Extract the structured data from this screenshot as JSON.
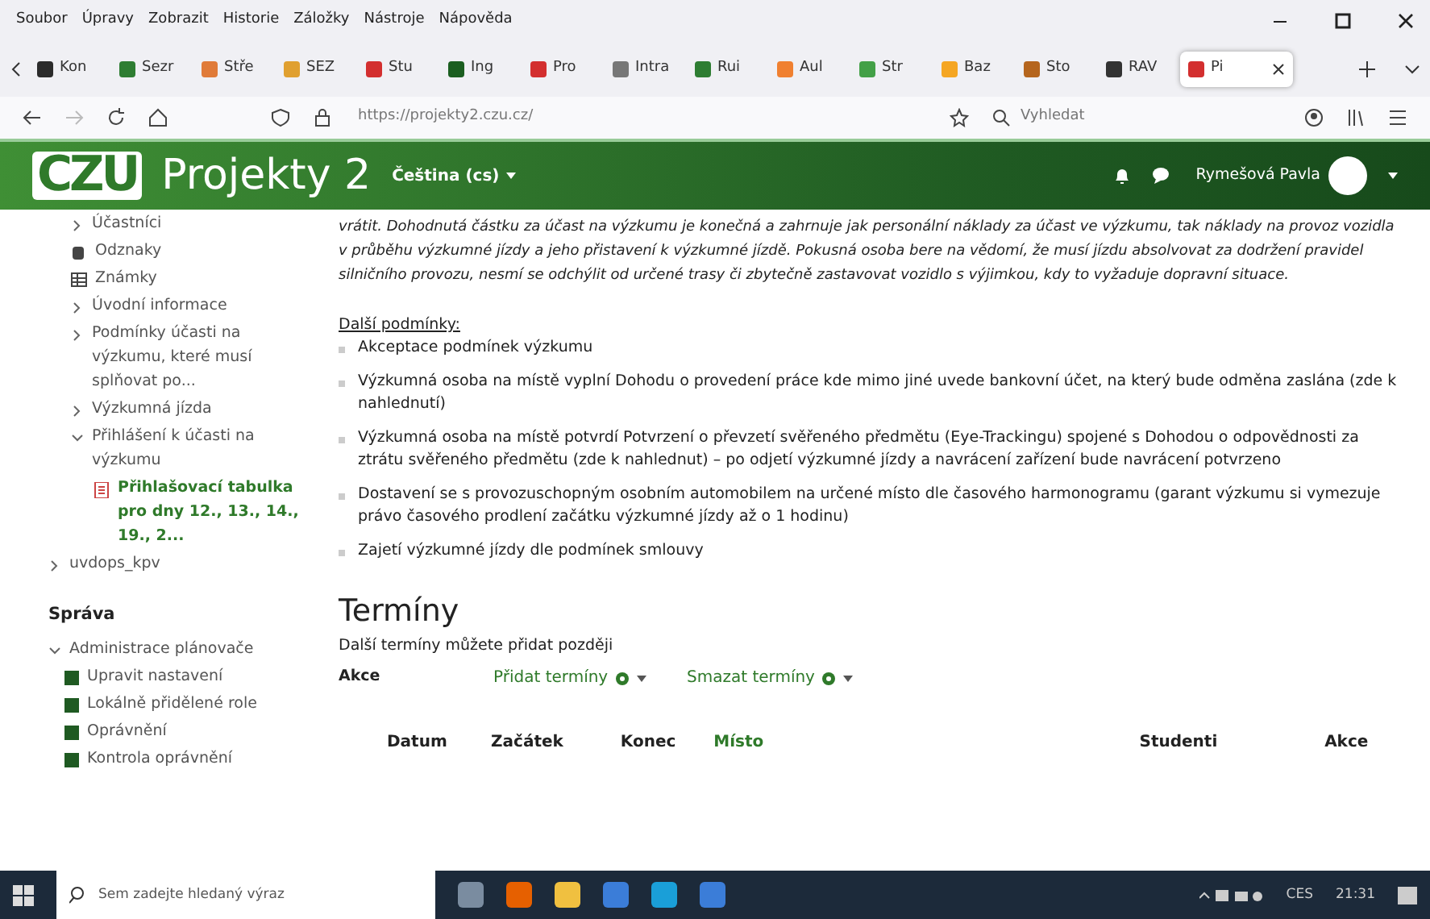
{
  "menu_bar": [
    "Soubor",
    "Úpravy",
    "Zobrazit",
    "Historie",
    "Záložky",
    "Nástroje",
    "Nápověda"
  ],
  "tabs": [
    {
      "label": "Kon",
      "color": "#2b2b2b",
      "selected": false
    },
    {
      "label": "Sezr",
      "color": "#2e7d32",
      "selected": false
    },
    {
      "label": "Stře",
      "color": "#e07b39",
      "selected": false
    },
    {
      "label": "SEZ",
      "color": "#e0a030",
      "selected": false
    },
    {
      "label": "Stu",
      "color": "#d32f2f",
      "selected": false
    },
    {
      "label": "Ing",
      "color": "#1b5e20",
      "selected": false
    },
    {
      "label": "Pro",
      "color": "#d32f2f",
      "selected": false
    },
    {
      "label": "Intra",
      "color": "#777777",
      "selected": false
    },
    {
      "label": "Rui",
      "color": "#2e7d32",
      "selected": false
    },
    {
      "label": "Aul",
      "color": "#f08030",
      "selected": false
    },
    {
      "label": "Str",
      "color": "#43a047",
      "selected": false
    },
    {
      "label": "Baz",
      "color": "#f5a623",
      "selected": false
    },
    {
      "label": "Sto",
      "color": "#b5651d",
      "selected": false
    },
    {
      "label": "RAV",
      "color": "#333333",
      "selected": false
    },
    {
      "label": "Pi",
      "color": "#d32f2f",
      "selected": true
    }
  ],
  "address": {
    "url": "https://projekty2.czu.cz/",
    "search_placeholder": "Vyhledat"
  },
  "header": {
    "logo": "CZU",
    "title": "Projekty 2",
    "language": "Čeština (cs)",
    "user": "Rymešová Pavla"
  },
  "sidebar": {
    "items": [
      {
        "kind": "section",
        "label": "Účastníci",
        "expanded": false
      },
      {
        "kind": "badge",
        "label": "Odznaky"
      },
      {
        "kind": "grades",
        "label": "Známky"
      },
      {
        "kind": "section",
        "label": "Úvodní informace",
        "expanded": false
      },
      {
        "kind": "section",
        "label": "Podmínky účasti na výzkumu, které musí splňovat po...",
        "expanded": false
      },
      {
        "kind": "section",
        "label": "Výzkumná jízda",
        "expanded": false
      },
      {
        "kind": "section",
        "label": "Přihlášení k účasti na výzkumu",
        "expanded": true,
        "children": [
          {
            "kind": "page",
            "label": "Přihlašovací tabulka pro dny 12., 13., 14., 19., 2...",
            "selected": true
          }
        ]
      }
    ],
    "course": {
      "kind": "section",
      "label": "uvdops_kpv",
      "expanded": false
    },
    "admin_title": "Správa",
    "admin": {
      "label": "Administrace plánovače",
      "expanded": true,
      "children": [
        "Upravit nastavení",
        "Lokálně přidělené role",
        "Oprávnění",
        "Kontrola oprávnění"
      ]
    }
  },
  "content": {
    "paragraph": "vrátit. Dohodnutá částku za účast na výzkumu je konečná a zahrnuje jak personální náklady za účast ve výzkumu, tak náklady na provoz vozidla v průběhu výzkumné jízdy a jeho přistavení k výzkumné jízdě. Pokusná osoba bere na vědomí, že musí jízdu absolvovat za dodržení pravidel silničního provozu, nesmí se odchýlit od určené trasy či zbytečně zastavovat vozidlo s výjimkou, kdy to vyžaduje dopravní situace.",
    "conditions_title": "Další podmínky:",
    "conditions": [
      "Akceptace podmínek výzkumu",
      "Výzkumná osoba na místě vyplní Dohodu o provedení práce kde mimo jiné uvede bankovní účet, na který bude odměna zaslána (zde k nahlednutí)",
      "Výzkumná osoba na místě potvrdí Potvrzení o převzetí svěřeného předmětu (Eye-Trackingu) spojené s Dohodou o odpovědnosti za ztrátu svěřeného předmětu (zde k nahlednut) – po odjetí výzkumné jízdy a navrácení zařízení bude navrácení potvrzeno",
      "Dostavení se s provozuschopným osobním automobilem na určené místo dle časového harmonogramu (garant výzkumu si vymezuje právo časového prodlení začátku výzkumné jízdy až o 1 hodinu)",
      "Zajetí výzkumné jízdy dle podmínek smlouvy"
    ]
  },
  "terms": {
    "title": "Termíny",
    "subtitle": "Další termíny můžete přidat později",
    "actions_label": "Akce",
    "actions": [
      "Přidat termíny",
      "Smazat termíny"
    ],
    "columns": [
      {
        "label": "Datum",
        "sortable": false
      },
      {
        "label": "Začátek",
        "sortable": false
      },
      {
        "label": "Konec",
        "sortable": false
      },
      {
        "label": "Místo",
        "sortable": true
      },
      {
        "label": "Studenti",
        "sortable": false
      },
      {
        "label": "Akce",
        "sortable": false
      }
    ]
  },
  "taskbar": {
    "search_placeholder": "Sem zadejte hledaný výraz",
    "language": "CES",
    "time": "21:31"
  }
}
